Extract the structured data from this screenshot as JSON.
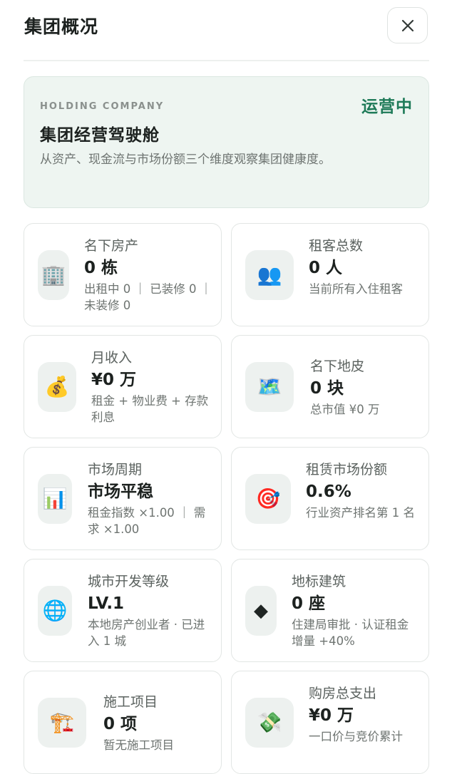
{
  "header": {
    "title": "集团概况"
  },
  "hero": {
    "kicker": "HOLDING COMPANY",
    "status": "运营中",
    "title": "集团经营驾驶舱",
    "description": "从资产、现金流与市场份额三个维度观察集团健康度。"
  },
  "cards": [
    {
      "label": "名下房产",
      "value": "0 栋",
      "sub": "出租中 0 ｜ 已装修 0 ｜ 未装修 0",
      "icon": "office-building-icon",
      "glyph": "🏢"
    },
    {
      "label": "租客总数",
      "value": "0 人",
      "sub": "当前所有入住租客",
      "icon": "people-icon",
      "glyph": "👥"
    },
    {
      "label": "月收入",
      "value": "¥0 万",
      "sub": "租金 + 物业费 + 存款利息",
      "icon": "money-bag-icon",
      "glyph": "💰"
    },
    {
      "label": "名下地皮",
      "value": "0 块",
      "sub": "总市值 ¥0 万",
      "icon": "world-map-icon",
      "glyph": "🗺️"
    },
    {
      "label": "市场周期",
      "value": "市场平稳",
      "sub": "租金指数 ×1.00 ｜ 需求 ×1.00",
      "icon": "bar-chart-icon",
      "glyph": "📊"
    },
    {
      "label": "租赁市场份额",
      "value": "0.6%",
      "sub": "行业资产排名第 1 名",
      "icon": "target-icon",
      "glyph": "🎯"
    },
    {
      "label": "城市开发等级",
      "value": "LV.1",
      "sub": "本地房产创业者 · 已进入 1 城",
      "icon": "globe-icon",
      "glyph": "🌐"
    },
    {
      "label": "地标建筑",
      "value": "0 座",
      "sub": "住建局审批 · 认证租金增量 +40%",
      "icon": "diamond-icon",
      "glyph": "◆"
    },
    {
      "label": "施工项目",
      "value": "0 项",
      "sub": "暂无施工项目",
      "icon": "construction-crane-icon",
      "glyph": "🏗️"
    },
    {
      "label": "购房总支出",
      "value": "¥0 万",
      "sub": "一口价与竞价累计",
      "icon": "money-wings-icon",
      "glyph": "💸"
    }
  ]
}
